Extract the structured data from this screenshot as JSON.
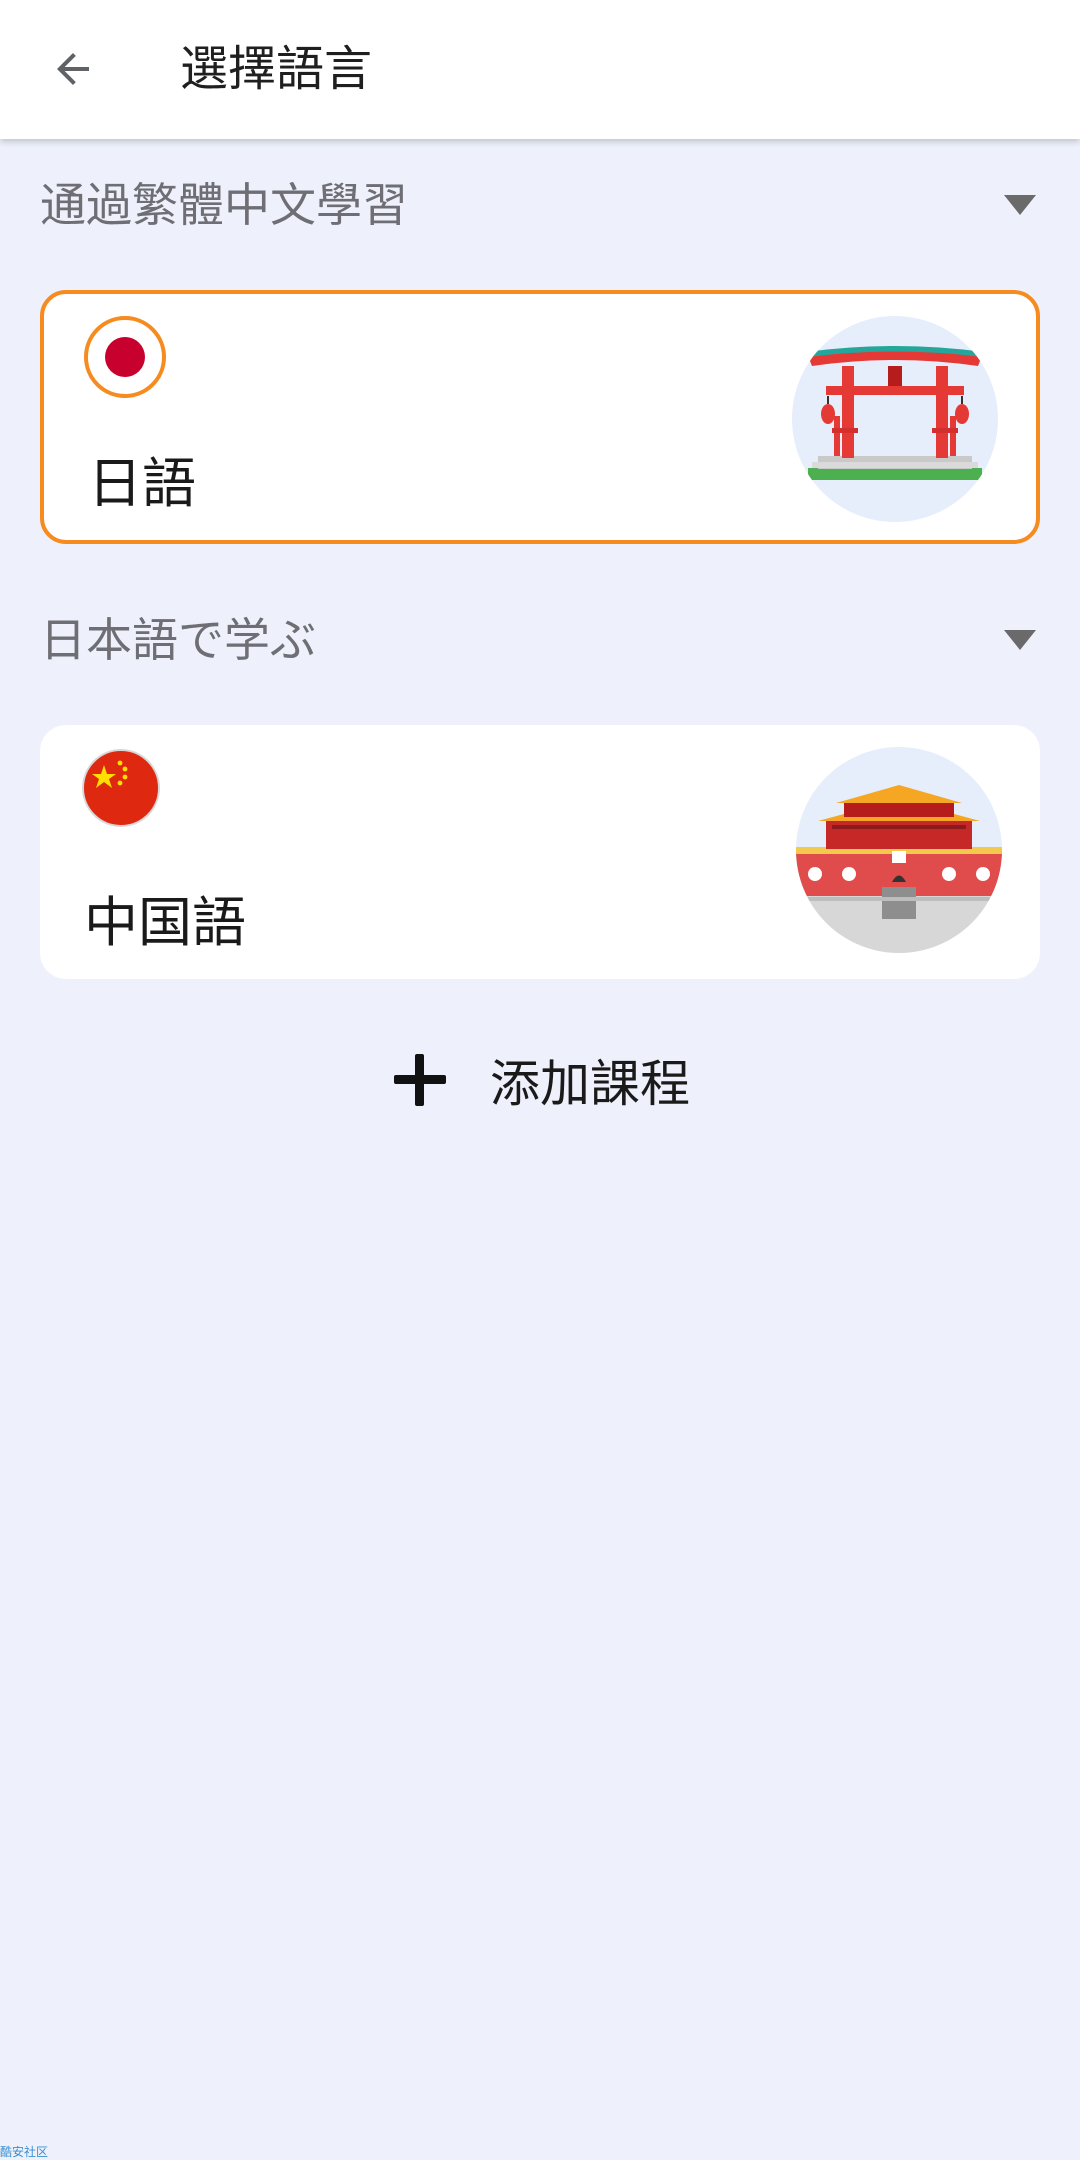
{
  "appbar": {
    "title": "選擇語言",
    "back_icon": "arrow-left-icon"
  },
  "sections": [
    {
      "title": "通過繁體中文學習",
      "toggle_icon": "triangle-down-icon",
      "courses": [
        {
          "name": "日語",
          "flag": "japan-flag-icon",
          "art": "torii-gate-illustration",
          "selected": true
        }
      ]
    },
    {
      "title": "日本語で学ぶ",
      "toggle_icon": "triangle-down-icon",
      "courses": [
        {
          "name": "中国語",
          "flag": "china-flag-icon",
          "art": "tiananmen-gate-illustration",
          "selected": false
        }
      ]
    }
  ],
  "add_course": {
    "label": "添加課程",
    "icon": "plus-icon"
  },
  "watermark": "酷安社区",
  "colors": {
    "accent": "#F68B1F",
    "background": "#EEF1FB",
    "card": "#FFFFFF"
  }
}
